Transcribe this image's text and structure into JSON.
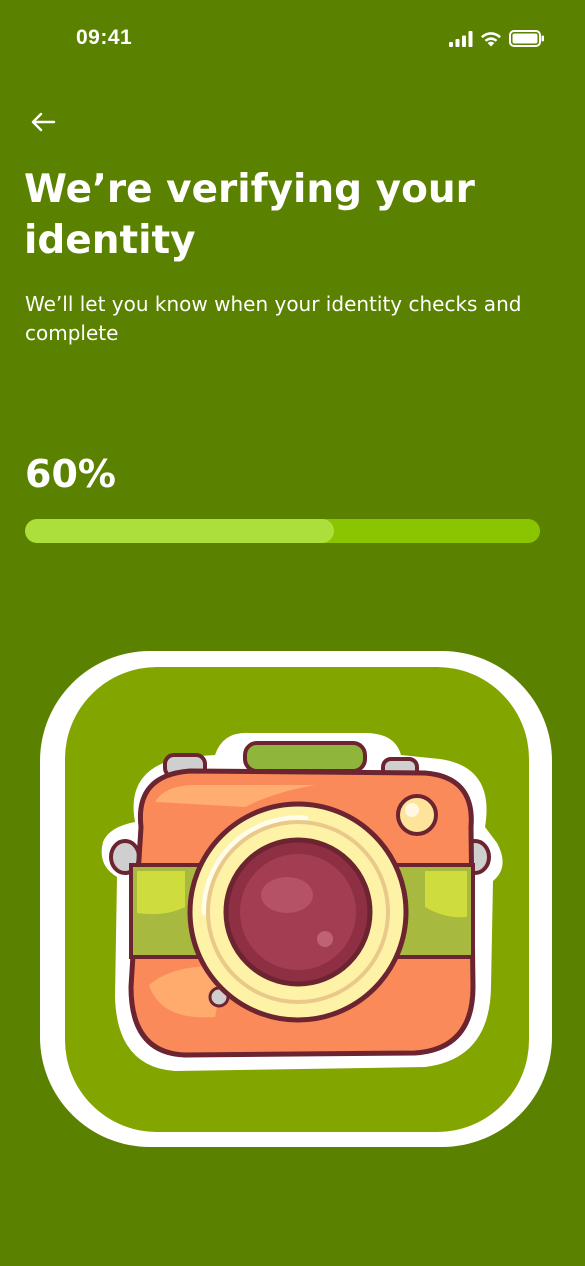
{
  "status_bar": {
    "time": "09:41",
    "icons": [
      "cellular-signal-icon",
      "wifi-icon",
      "battery-icon"
    ]
  },
  "header": {
    "back_icon": "arrow-left-icon",
    "title": "We’re verifying your identity",
    "subtitle": "We’ll let you know when your identity checks and complete"
  },
  "progress": {
    "label": "60%",
    "value": 0.6
  },
  "illustration": {
    "icon": "camera-icon"
  },
  "colors": {
    "background": "#5a8200",
    "progress_track": "#8bc400",
    "progress_fill": "#acdf3b",
    "card_border": "#ffffff",
    "card_fill": "#82a500"
  }
}
